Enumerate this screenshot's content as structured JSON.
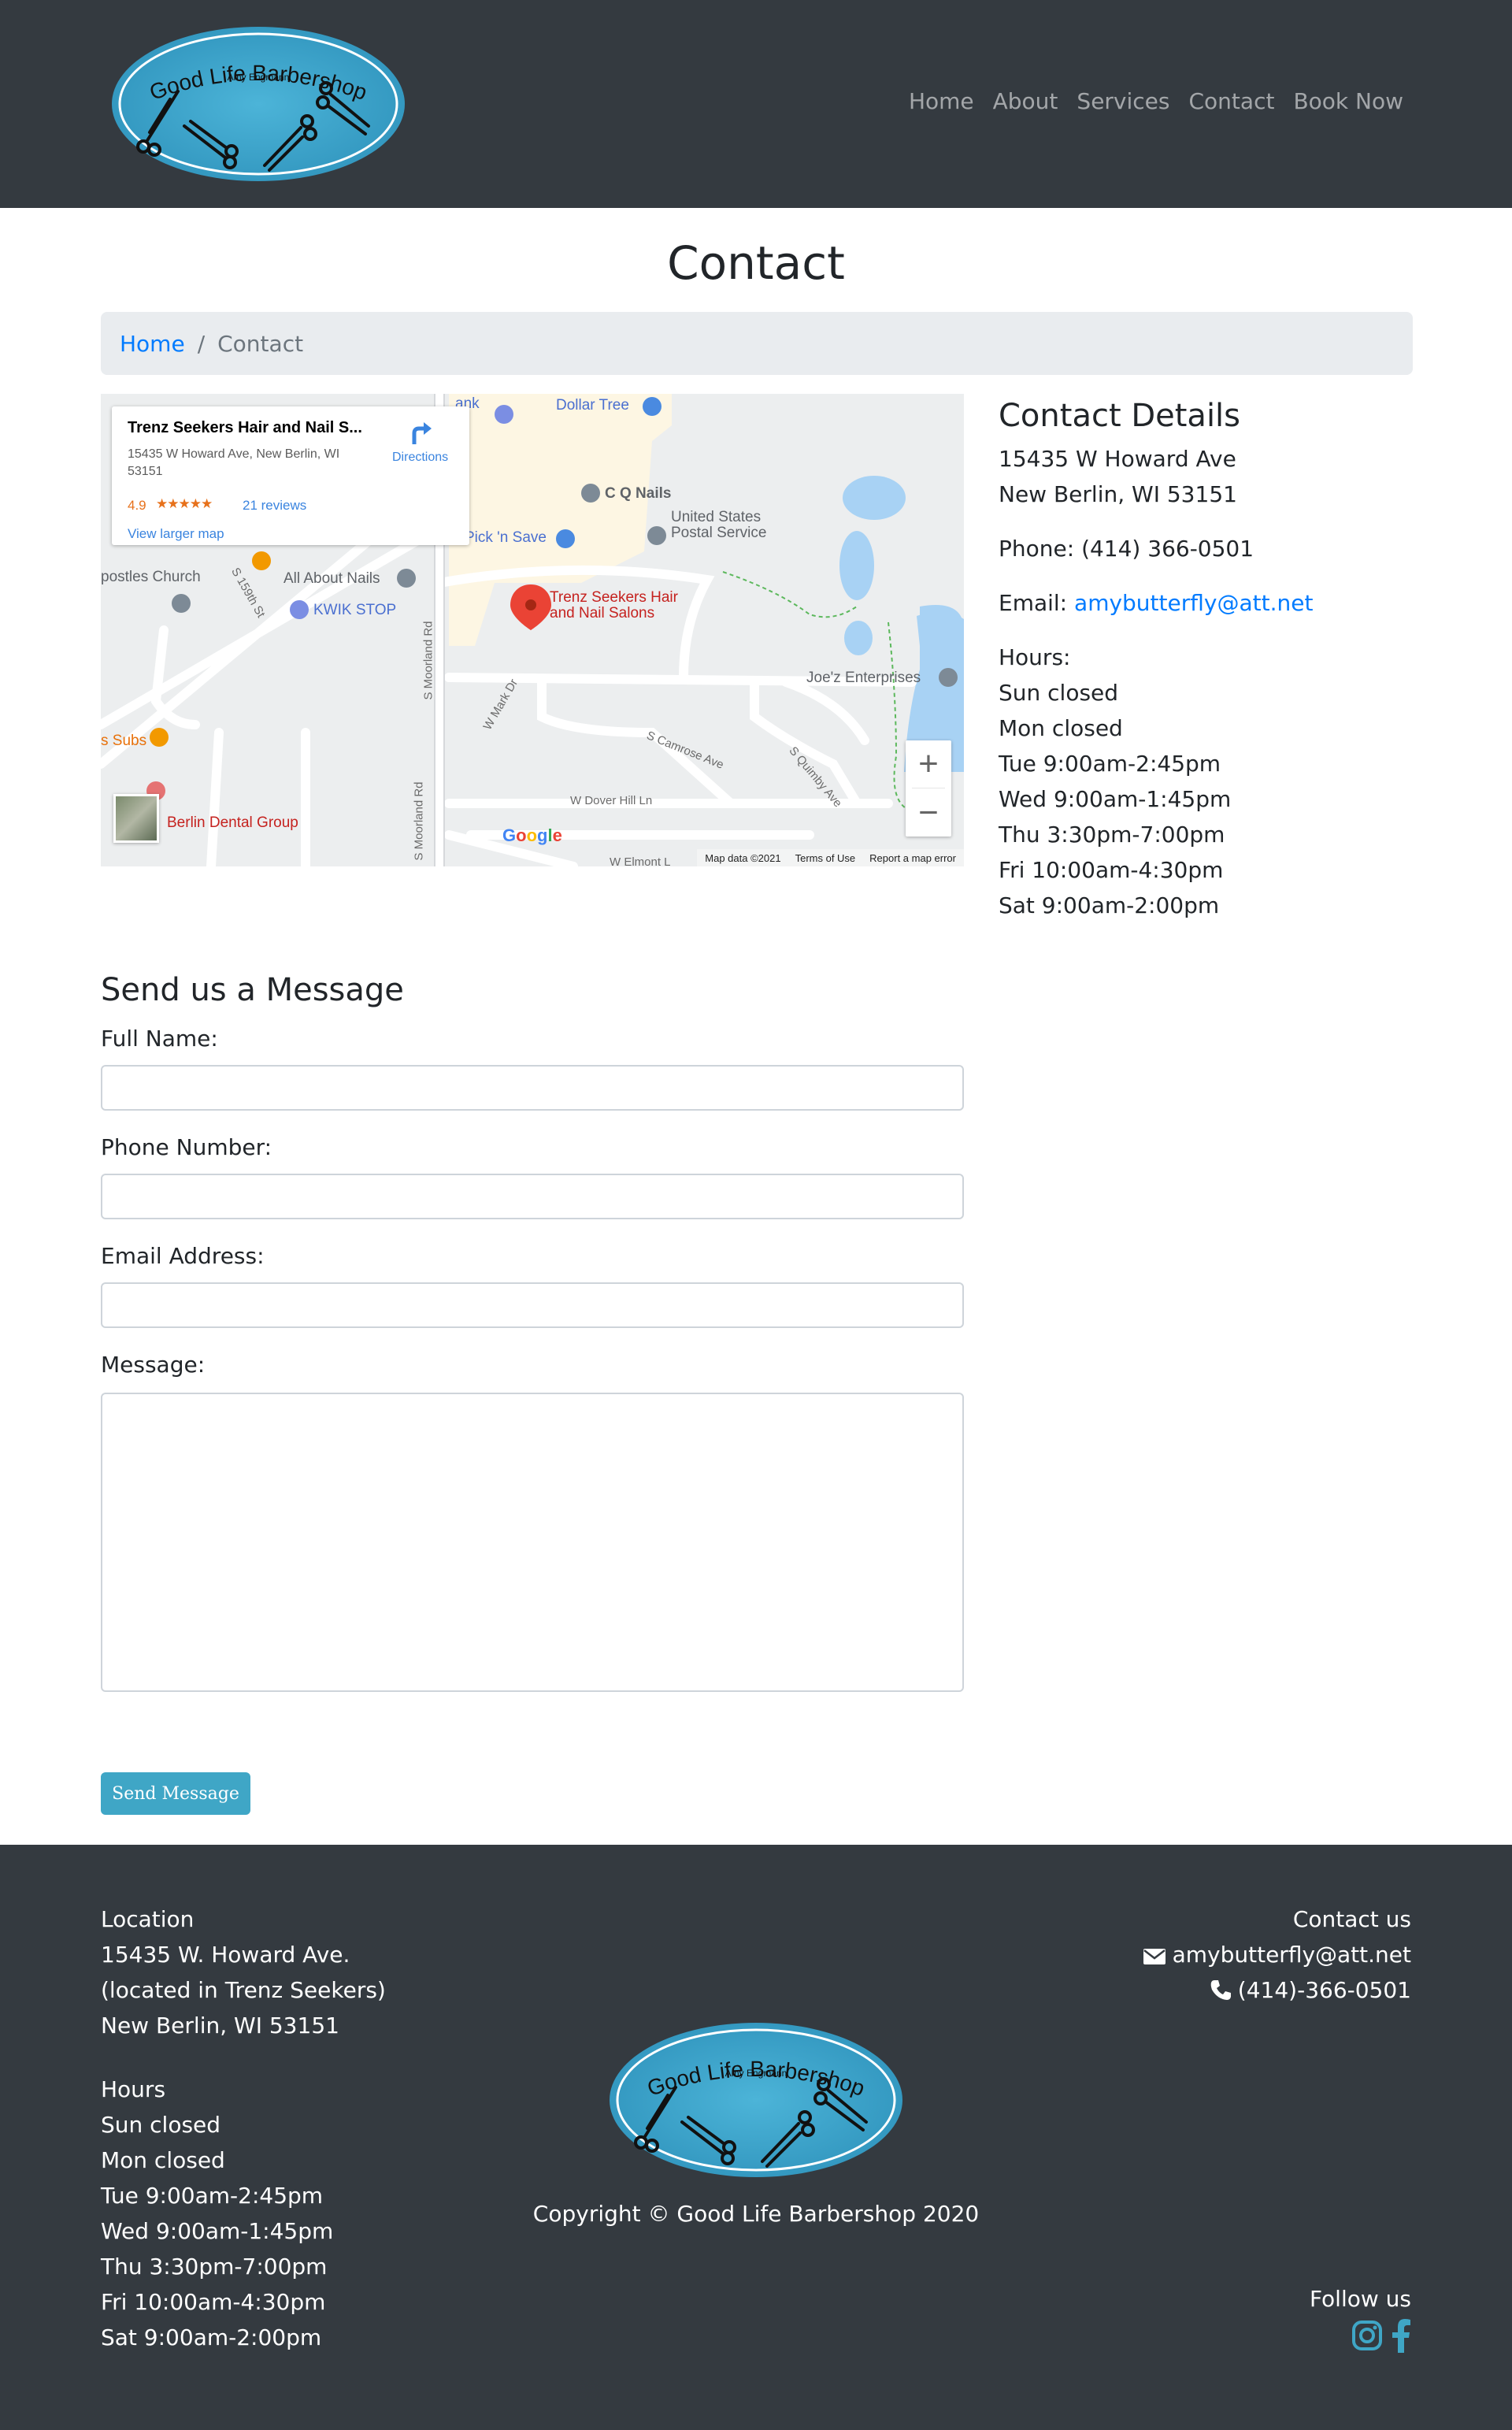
{
  "nav": {
    "logo": {
      "title": "Good Life Barbershop",
      "subtitle": "Amy Engmann"
    },
    "links": [
      "Home",
      "About",
      "Services",
      "Contact",
      "Book Now"
    ]
  },
  "page": {
    "title": "Contact",
    "breadcrumb": {
      "home": "Home",
      "separator": "/",
      "current": "Contact"
    }
  },
  "map": {
    "place_name": "Trenz Seekers Hair and Nail S...",
    "address_line1": "15435 W Howard Ave, New Berlin, WI",
    "address_line2": "53151",
    "rating": "4.9",
    "stars": "★★★★★",
    "reviews": "21 reviews",
    "view_larger": "View larger map",
    "directions": "Directions",
    "marker_label_1": "Trenz Seekers Hair",
    "marker_label_2": "and Nail Salons",
    "labels": {
      "dollar_tree": "Dollar Tree",
      "bank": "ank",
      "cq_nails": "C Q Nails",
      "usps_1": "United States",
      "usps_2": "Postal Service",
      "pick_n_save": "Pick 'n Save",
      "church": "postles Church",
      "all_about_nails": "All About Nails",
      "kwik_stop": "KWIK STOP",
      "joez": "Joe'z Enterprises",
      "subs": "s Subs",
      "dental": "Berlin Dental Group",
      "s_moorland_1": "S Moorland Rd",
      "s_moorland_2": "S Moorland Rd",
      "s_159th": "S 159th St",
      "w_mark": "W Mark Dr",
      "s_camrose": "S Camrose Ave",
      "s_quimby": "S Quimby Ave",
      "w_dover": "W Dover Hill Ln",
      "w_elmont": "W Elmont L"
    },
    "zoom_in": "+",
    "zoom_out": "−",
    "google": [
      "G",
      "o",
      "o",
      "g",
      "l",
      "e"
    ],
    "footer": {
      "data": "Map data ©2021",
      "terms": "Terms of Use",
      "report": "Report a map error"
    }
  },
  "details": {
    "heading": "Contact Details",
    "address_line1": "15435 W Howard Ave",
    "address_line2": "New Berlin, WI 53151",
    "phone": "Phone: (414) 366-0501",
    "email_label": "Email:",
    "email": "amybutterfly@att.net",
    "hours_label": "Hours:",
    "hours": [
      "Sun closed",
      "Mon closed",
      "Tue 9:00am-2:45pm",
      "Wed 9:00am-1:45pm",
      "Thu 3:30pm-7:00pm",
      "Fri 10:00am-4:30pm",
      "Sat 9:00am-2:00pm"
    ]
  },
  "form": {
    "heading": "Send us a Message",
    "full_name_label": "Full Name:",
    "phone_label": "Phone Number:",
    "email_label": "Email Address:",
    "message_label": "Message:",
    "full_name_value": "",
    "phone_value": "",
    "email_value": "",
    "message_value": "",
    "submit": "Send Message"
  },
  "footer": {
    "location_heading": "Location",
    "location_lines": [
      "15435 W. Howard Ave.",
      "(located in Trenz Seekers)",
      "New Berlin, WI 53151"
    ],
    "hours_heading": "Hours",
    "hours": [
      "Sun closed",
      "Mon closed",
      "Tue 9:00am-2:45pm",
      "Wed 9:00am-1:45pm",
      "Thu 3:30pm-7:00pm",
      "Fri 10:00am-4:30pm",
      "Sat 9:00am-2:00pm"
    ],
    "contact_heading": "Contact us",
    "email": "amybutterfly@att.net",
    "phone": "(414)-366-0501",
    "copyright": "Copyright © Good Life Barbershop 2020",
    "follow_heading": "Follow us"
  },
  "colors": {
    "navbar_bg": "#343a40",
    "link_blue": "#007bff",
    "accent": "#3fa6c6",
    "social_icon": "#3fa6c6",
    "logo_water": "#3a9fc8"
  },
  "icons": [
    "scissors-icon",
    "envelope-icon",
    "phone-icon",
    "instagram-icon",
    "facebook-icon",
    "map-pin-icon",
    "directions-icon"
  ]
}
